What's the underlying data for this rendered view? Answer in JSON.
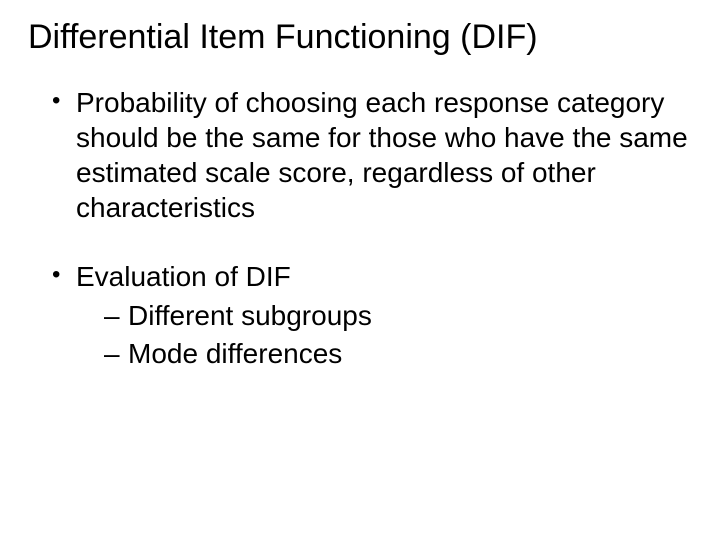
{
  "title": "Differential Item Functioning (DIF)",
  "bullets": {
    "b1": "Probability of choosing each response category should be the same for those who have the same estimated scale score, regardless of other characteristics",
    "b2": "Evaluation of DIF",
    "b2_sub": {
      "s1": "Different subgroups",
      "s2": "Mode differences"
    }
  }
}
